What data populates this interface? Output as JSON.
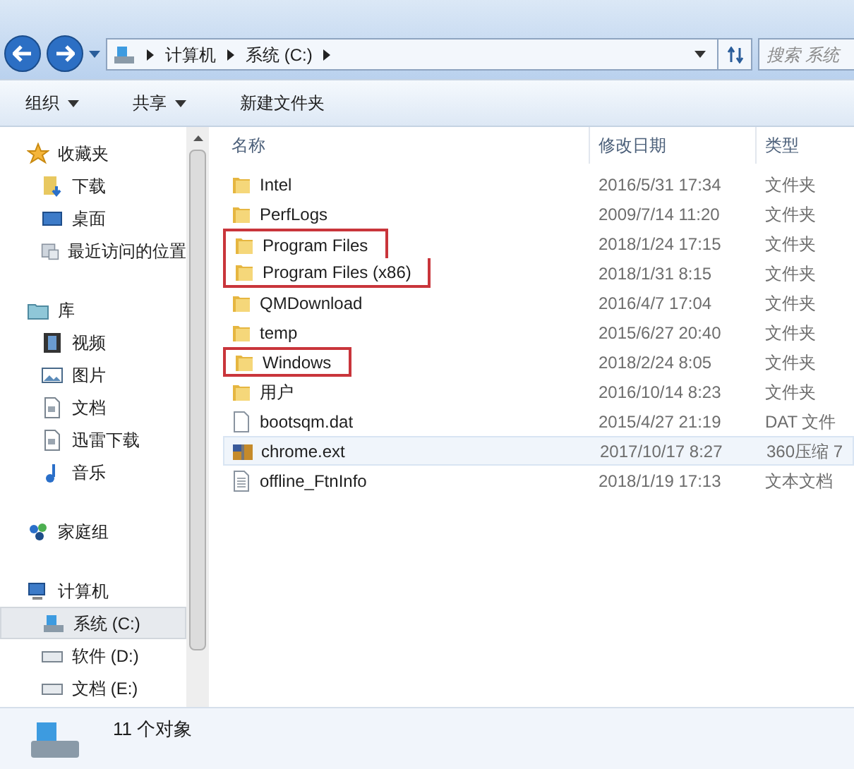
{
  "address": {
    "crumbs": [
      "计算机",
      "系统 (C:)"
    ]
  },
  "search": {
    "placeholder": "搜索 系统"
  },
  "toolbar": [
    {
      "label": "组织",
      "dropdown": true
    },
    {
      "label": "共享",
      "dropdown": true
    },
    {
      "label": "新建文件夹",
      "dropdown": false
    }
  ],
  "sidebar": {
    "groups": [
      {
        "label": "收藏夹",
        "kind": "star",
        "children": [
          {
            "label": "下载",
            "kind": "download",
            "selected": false
          },
          {
            "label": "桌面",
            "kind": "desktop",
            "selected": false
          },
          {
            "label": "最近访问的位置",
            "kind": "recent",
            "selected": false
          }
        ]
      },
      {
        "label": "库",
        "kind": "library",
        "children": [
          {
            "label": "视频",
            "kind": "video",
            "selected": false
          },
          {
            "label": "图片",
            "kind": "picture",
            "selected": false
          },
          {
            "label": "文档",
            "kind": "doc",
            "selected": false
          },
          {
            "label": "迅雷下载",
            "kind": "doc",
            "selected": false
          },
          {
            "label": "音乐",
            "kind": "music",
            "selected": false
          }
        ]
      },
      {
        "label": "家庭组",
        "kind": "homegroup"
      },
      {
        "label": "计算机",
        "kind": "computer",
        "children": [
          {
            "label": "系统 (C:)",
            "kind": "drive",
            "selected": true
          },
          {
            "label": "软件 (D:)",
            "kind": "drive2",
            "selected": false
          },
          {
            "label": "文档 (E:)",
            "kind": "drive2",
            "selected": false
          }
        ]
      }
    ]
  },
  "table": {
    "columns": [
      "名称",
      "修改日期",
      "类型"
    ],
    "rows": [
      {
        "kind": "folder",
        "name": "Intel",
        "date": "2016/5/31 17:34",
        "type": "文件夹",
        "boxed": false,
        "hovered": false
      },
      {
        "kind": "folder",
        "name": "PerfLogs",
        "date": "2009/7/14 11:20",
        "type": "文件夹",
        "boxed": false,
        "hovered": false
      },
      {
        "kind": "folder",
        "name": "Program Files",
        "date": "2018/1/24 17:15",
        "type": "文件夹",
        "boxed": true,
        "hovered": false
      },
      {
        "kind": "folder",
        "name": "Program Files (x86)",
        "date": "2018/1/31 8:15",
        "type": "文件夹",
        "boxed": true,
        "hovered": false
      },
      {
        "kind": "folder",
        "name": "QMDownload",
        "date": "2016/4/7 17:04",
        "type": "文件夹",
        "boxed": false,
        "hovered": false
      },
      {
        "kind": "folder",
        "name": "temp",
        "date": "2015/6/27 20:40",
        "type": "文件夹",
        "boxed": false,
        "hovered": false
      },
      {
        "kind": "folder",
        "name": "Windows",
        "date": "2018/2/24 8:05",
        "type": "文件夹",
        "boxed": true,
        "hovered": false
      },
      {
        "kind": "folder",
        "name": "用户",
        "date": "2016/10/14 8:23",
        "type": "文件夹",
        "boxed": false,
        "hovered": false
      },
      {
        "kind": "file",
        "name": "bootsqm.dat",
        "date": "2015/4/27 21:19",
        "type": "DAT 文件",
        "boxed": false,
        "hovered": false
      },
      {
        "kind": "archive",
        "name": "chrome.ext",
        "date": "2017/10/17 8:27",
        "type": "360压缩 7",
        "boxed": false,
        "hovered": true
      },
      {
        "kind": "text",
        "name": "offline_FtnInfo",
        "date": "2018/1/19 17:13",
        "type": "文本文档",
        "boxed": false,
        "hovered": false
      }
    ]
  },
  "status_bar": {
    "count": "11 个对象"
  }
}
